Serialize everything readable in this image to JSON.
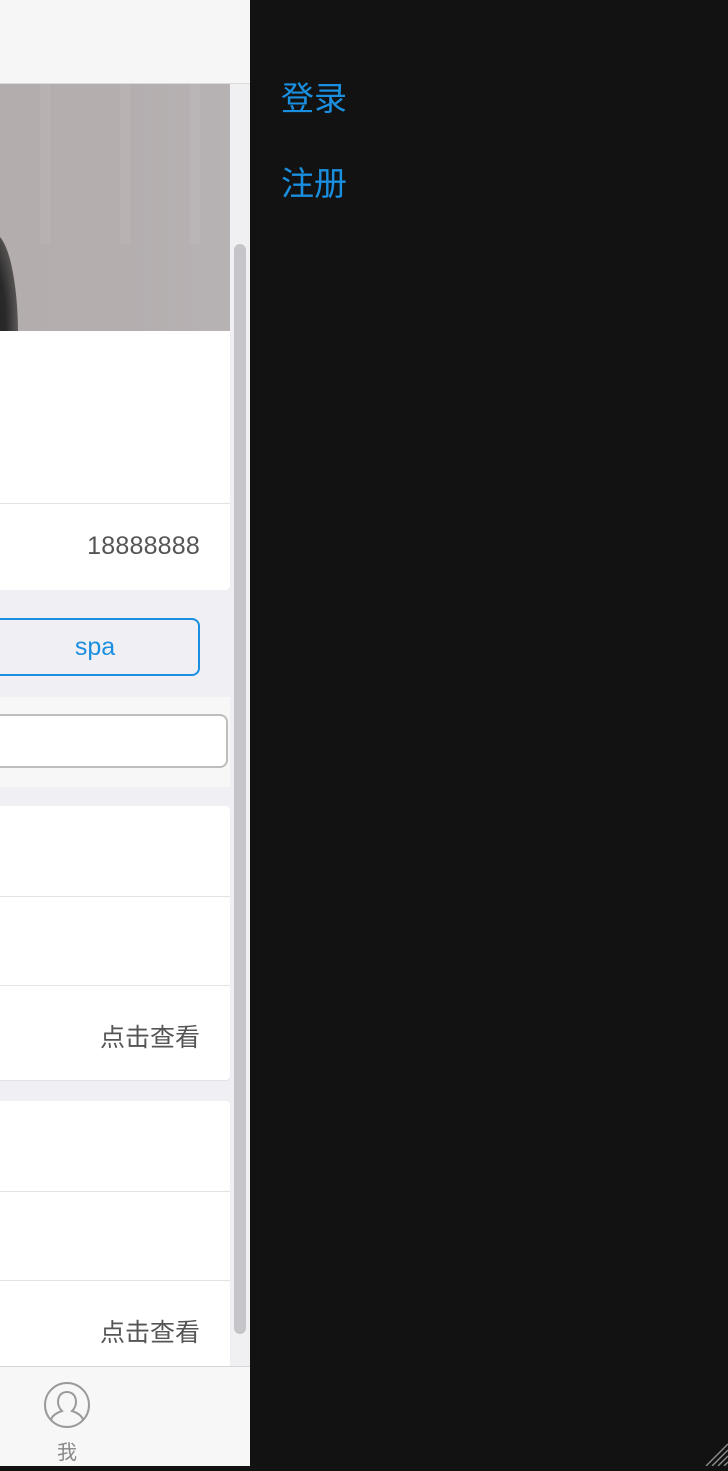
{
  "main": {
    "profile": {
      "phone": "18888888"
    },
    "spa_button_label": "spa",
    "cards": [
      {
        "view_label": "点击查看"
      },
      {
        "view_label": "点击查看"
      }
    ]
  },
  "tabbar": {
    "me_label": "我"
  },
  "side_menu": {
    "login_label": "登录",
    "register_label": "注册"
  },
  "colors": {
    "accent": "#1a8fe0",
    "menu_background": "#121212",
    "page_background": "#efeff4"
  },
  "icons": {
    "tab_me": "user-icon",
    "corner": "resize-grip-icon"
  }
}
